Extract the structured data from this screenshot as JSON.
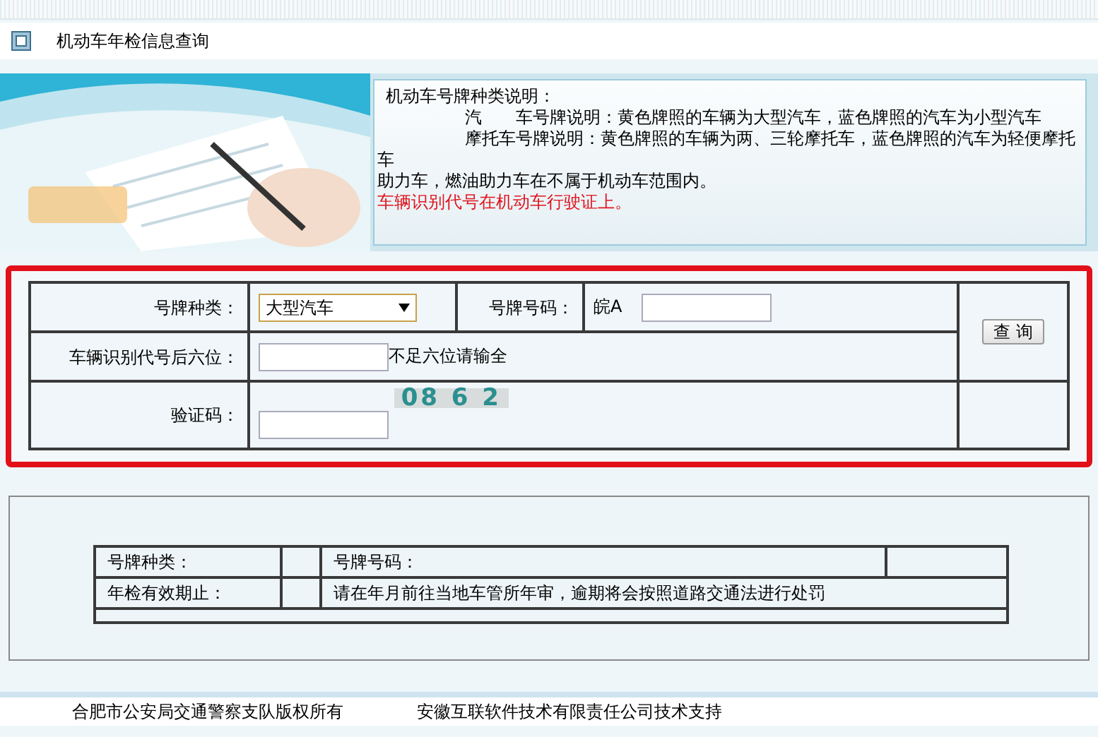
{
  "page_title": "机动车年检信息查询",
  "notice": {
    "lines": [
      {
        "text": "机动车号牌种类说明：",
        "indented": false,
        "kind": "normal"
      },
      {
        "text": "汽　　车号牌说明：黄色牌照的车辆为大型汽车，蓝色牌照的汽车为小型汽车",
        "indented": true,
        "kind": "normal"
      },
      {
        "text": "摩托车号牌说明：黄色牌照的车辆为两、三轮摩托车，蓝色牌照的汽车为轻便摩托",
        "indented": true,
        "kind": "normal"
      },
      {
        "text": "车",
        "indented": false,
        "kind": "normal"
      },
      {
        "text": "助力车，燃油助力车在不属于机动车范围内。",
        "indented": false,
        "kind": "normal"
      },
      {
        "text": "车辆识别代号在机动车行驶证上。",
        "indented": false,
        "kind": "warning"
      }
    ]
  },
  "form": {
    "plate_type_label": "号牌种类：",
    "plate_type_value": "大型汽车",
    "plate_number_label": "号牌号码：",
    "plate_prefix": "皖A",
    "vin_label": "车辆识别代号后六位：",
    "vin_hint": "不足六位请输全",
    "captcha_label": "验证码：",
    "captcha": "08 6 2",
    "query_button": "查 询"
  },
  "result": {
    "rows": [
      {
        "label": "号牌种类：",
        "label_2": "号牌号码："
      },
      {
        "label": "年检有效期止：",
        "message": "请在年月前往当地车管所年审，逾期将会按照道路交通法进行处罚"
      }
    ]
  },
  "footer": [
    "合肥市公安局交通警察支队版权所有",
    "安徽互联软件技术有限责任公司技术支持"
  ]
}
